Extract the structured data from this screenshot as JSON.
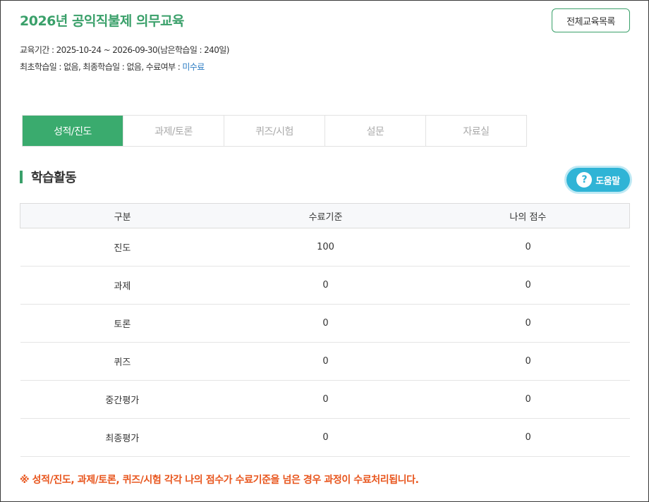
{
  "header": {
    "title": "2026년 공익직불제 의무교육",
    "list_button": "전체교육목록"
  },
  "info": {
    "period": "교육기간 : 2025-10-24 ~ 2026-09-30(남은학습일 : 240일)",
    "learning": "최초학습일 : 없음, 최종학습일 : 없음, 수료여부 : ",
    "completion_status": "미수료"
  },
  "tabs": [
    {
      "label": "성적/진도",
      "active": true
    },
    {
      "label": "과제/토론",
      "active": false
    },
    {
      "label": "퀴즈/시험",
      "active": false
    },
    {
      "label": "설문",
      "active": false
    },
    {
      "label": "자료실",
      "active": false
    }
  ],
  "section": {
    "title": "학습활동",
    "help_label": "도움말",
    "help_icon": "question-icon"
  },
  "table": {
    "headers": [
      "구분",
      "수료기준",
      "나의 점수"
    ],
    "rows": [
      [
        "진도",
        "100",
        "0"
      ],
      [
        "과제",
        "0",
        "0"
      ],
      [
        "토론",
        "0",
        "0"
      ],
      [
        "퀴즈",
        "0",
        "0"
      ],
      [
        "중간평가",
        "0",
        "0"
      ],
      [
        "최종평가",
        "0",
        "0"
      ]
    ]
  },
  "notice": "※ 성적/진도, 과제/토론, 퀴즈/시험 각각 나의 점수가 수료기준을 넘은 경우 과정이 수료처리됩니다.",
  "colors": {
    "accent": "#3aab6e",
    "help": "#2fb4d6",
    "notice": "#e8561e",
    "status": "#2b7cc3"
  }
}
